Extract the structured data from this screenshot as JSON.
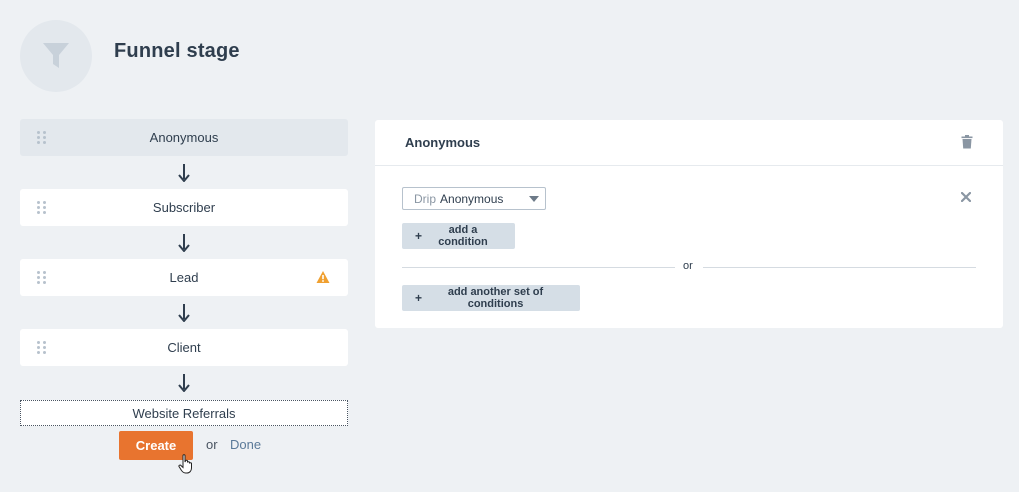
{
  "page": {
    "title": "Funnel stage",
    "icon": "funnel-icon"
  },
  "stages": [
    {
      "label": "Anonymous",
      "active": true,
      "warning": false
    },
    {
      "label": "Subscriber",
      "active": false,
      "warning": false
    },
    {
      "label": "Lead",
      "active": false,
      "warning": true
    },
    {
      "label": "Client",
      "active": false,
      "warning": false
    }
  ],
  "new_stage": {
    "value": "Website Referrals",
    "create_label": "Create",
    "or_label": "or",
    "done_label": "Done"
  },
  "detail": {
    "title": "Anonymous",
    "condition": {
      "prefix": "Drip",
      "value": "Anonymous"
    },
    "add_condition_label": "add a condition",
    "or_label": "or",
    "add_set_label": "add another set of conditions"
  },
  "colors": {
    "accent": "#e8742f",
    "background": "#eef1f4",
    "warning": "#f0a030",
    "link": "#5b7a99"
  }
}
